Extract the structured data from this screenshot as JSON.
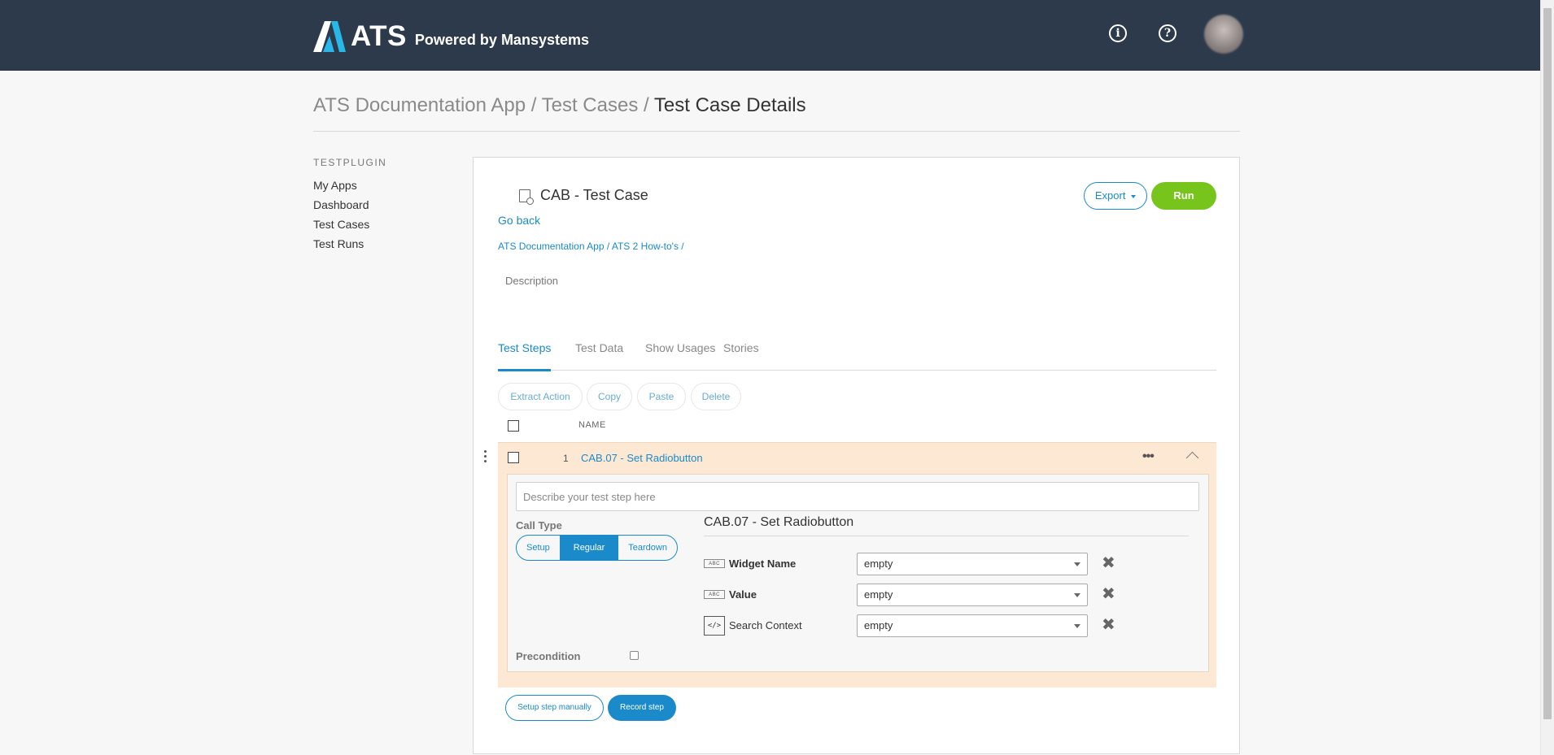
{
  "header": {
    "brand": "ATS",
    "tagline": "Powered by Mansystems",
    "info_icon": "info-icon",
    "help_icon": "help-icon"
  },
  "breadcrumb": {
    "app": "ATS Documentation App /",
    "section": "Test Cases /",
    "current": "Test Case Details"
  },
  "sidebar": {
    "heading": "TESTPLUGIN",
    "items": [
      {
        "label": "My Apps"
      },
      {
        "label": "Dashboard"
      },
      {
        "label": "Test Cases"
      },
      {
        "label": "Test Runs"
      }
    ]
  },
  "testcase": {
    "title": "CAB - Test Case",
    "go_back": "Go back",
    "path": "ATS Documentation App  /  ATS 2 How-to's  /",
    "description_label": "Description",
    "export_label": "Export",
    "run_label": "Run"
  },
  "tabs": [
    {
      "label": "Test Steps",
      "active": true
    },
    {
      "label": "Test Data"
    },
    {
      "label": "Show Usages"
    },
    {
      "label": "Stories"
    }
  ],
  "toolbar": {
    "extract": "Extract Action",
    "copy": "Copy",
    "paste": "Paste",
    "delete": "Delete"
  },
  "table": {
    "col_name": "NAME",
    "rows": [
      {
        "num": "1",
        "name": "CAB.07 - Set Radiobutton"
      }
    ]
  },
  "step_detail": {
    "placeholder": "Describe your test step here",
    "call_type_label": "Call Type",
    "call_types": [
      "Setup",
      "Regular",
      "Teardown"
    ],
    "call_type_selected": "Regular",
    "precondition_label": "Precondition",
    "action_title": "CAB.07 - Set Radiobutton",
    "params": [
      {
        "type_badge": "ABC",
        "name": "Widget Name",
        "value": "empty"
      },
      {
        "type_badge": "ABC",
        "name": "Value",
        "value": "empty"
      },
      {
        "type_badge": "</>",
        "name": "Search Context",
        "value": "empty"
      }
    ]
  },
  "footer_buttons": {
    "setup_manual": "Setup step manually",
    "record": "Record step"
  },
  "colors": {
    "topbar": "#2c3a4b",
    "accent": "#1a8acb",
    "run": "#76c41c",
    "row_highlight": "#fde9d3"
  }
}
